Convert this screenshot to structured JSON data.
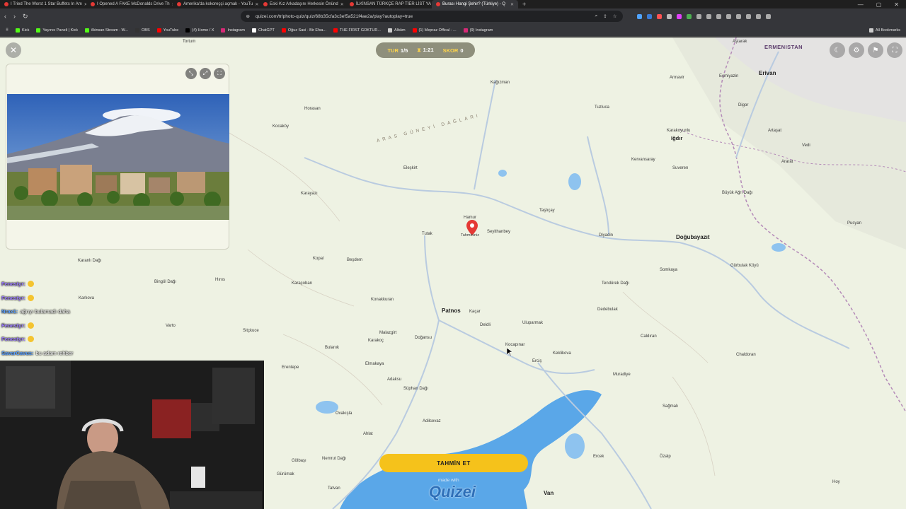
{
  "browser": {
    "tabs": [
      {
        "label": "I Tried The Worst 1 Star Buffets In Am"
      },
      {
        "label": "I Opened A FAKE McDonalds Drive Th"
      },
      {
        "label": "Amerika'da kokoreççi açmak - YouTu"
      },
      {
        "label": "Eski Kız Arkadaşını Herkesin Önünd"
      },
      {
        "label": "İLKİNSAN TÜRKÇE RAP TİER LİST YA"
      },
      {
        "label": "Burası Hangi Şehir? (Türkiye) - Q"
      }
    ],
    "new_tab": "+",
    "url": "quizei.com/tr/photo-quiz/quiz/68b35cfa3c3ef5a521f4ae2a/play?autoplay=true",
    "bookmarks": [
      {
        "label": "Kick",
        "color": "#53fc18"
      },
      {
        "label": "Yayıncı Paneli | Kick",
        "color": "#53fc18"
      },
      {
        "label": "ilkinsan Stream - W...",
        "color": "#53fc18"
      },
      {
        "label": "OBS",
        "color": "#333333"
      },
      {
        "label": "YouTube",
        "color": "#ff0000"
      },
      {
        "label": "(4) Home / X",
        "color": "#000000"
      },
      {
        "label": "Instagram",
        "color": "#d62976"
      },
      {
        "label": "ChatGPT",
        "color": "#ffffff"
      },
      {
        "label": "Oğuz Sasi - Bir Efsa...",
        "color": "#ff0000"
      },
      {
        "label": "THE FIRST GOKTUR...",
        "color": "#ff0000"
      },
      {
        "label": "Albüm",
        "color": "#cccccc"
      },
      {
        "label": "(1) Mepraz Offical - ...",
        "color": "#ff0000"
      },
      {
        "label": "(9) Instagram",
        "color": "#d62976"
      }
    ],
    "all_bookmarks": "All Bookmarks"
  },
  "quiz": {
    "round_label": "TUR",
    "round_value": "1/5",
    "timer": "1:21",
    "score_label": "SKOR",
    "score_value": "0",
    "guess_button": "TAHMİN ET",
    "made_with": "made with",
    "brand": "Quizei",
    "pin_label": "Tahmininiz"
  },
  "chat": [
    {
      "user": "Fenestyr:",
      "message": "",
      "style": "u1"
    },
    {
      "user": "Fenestyr:",
      "message": "",
      "style": "u1"
    },
    {
      "user": "Nrax1:",
      "message": "ağrıyı bulamadı daha",
      "style": "u2"
    },
    {
      "user": "Fenestyr:",
      "message": "",
      "style": "u1"
    },
    {
      "user": "Fenestyr:",
      "message": "",
      "style": "u1"
    },
    {
      "user": "SavarCavus:",
      "message": "bu adam rehber",
      "style": "u2"
    }
  ],
  "map": {
    "country": "ERMENISTAN",
    "range": "ARAS GÜNEYİ DAĞLARI",
    "cities": [
      "Erivan",
      "Patnos",
      "Doğubayazıt",
      "Van",
      "Iğdır"
    ],
    "towns": [
      "Tortum",
      "Kocaköy",
      "Kağızman",
      "Digor",
      "Armavir",
      "Eçmiyazin",
      "Aştarak",
      "Horasan",
      "Tuzluca",
      "Karakoyunlu",
      "Artaşat",
      "Ararat",
      "Vedi",
      "Eleşkirt",
      "Kervansaray",
      "Suveren",
      "Taşlıçay",
      "Karayazı",
      "Hamur",
      "Diyadin",
      "Tutak",
      "Seyithanbey",
      "Kopal",
      "Beşdem",
      "Karaçoban",
      "Konakkuran",
      "Somkaya",
      "Dedebulak",
      "Gürbulak Köyü",
      "Pusyan",
      "Hınıs",
      "Varto",
      "Bulanık",
      "Malazgirt",
      "Doğansu",
      "Uluparmak",
      "Deldli",
      "Kocapınar",
      "Erciş",
      "Keklikova",
      "Caldıran",
      "Chaldoran",
      "Erentepe",
      "Ovakışla",
      "Ahlat",
      "Adilcevaz",
      "Muradiye",
      "Sağmalı",
      "Gölbaşı",
      "Gürümak",
      "Tatvan",
      "Ercek",
      "Özalp",
      "Hoy",
      "Karlıova",
      "Sitçkuce",
      "Elmakaya",
      "Adaksu",
      "Kaçar",
      "Karakoç"
    ],
    "peaks": [
      "Karanlı Dağı",
      "Bingöl Dağı",
      "Büyük Ağrı Dağı",
      "Tendürek Dağı",
      "Süphan Dağı",
      "Nemrut Dağı"
    ],
    "colors": {
      "land": "#eef2e3",
      "water": "#5aa7e8",
      "road": "#c9d6e2",
      "pin": "#e53935",
      "button": "#f5c21b"
    }
  }
}
